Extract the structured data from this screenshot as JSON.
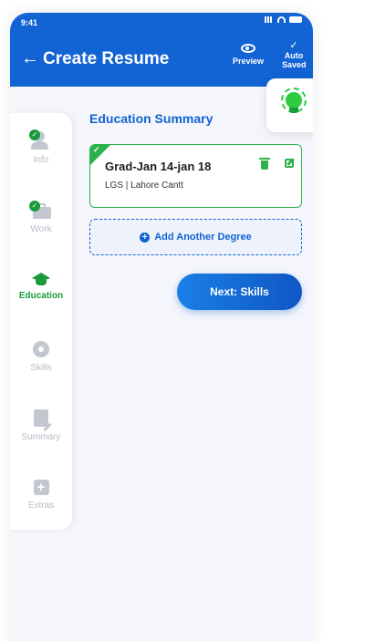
{
  "status_bar": {
    "time": "9:41"
  },
  "header": {
    "back_icon": "arrow-left-icon",
    "title": "Create Resume",
    "preview_label": "Preview",
    "autosave_line1": "Auto",
    "autosave_line2": "Saved",
    "color": "#1263d3"
  },
  "sidebar": {
    "items": [
      {
        "label": "Info",
        "icon": "person-icon",
        "completed": true,
        "active": false
      },
      {
        "label": "Work",
        "icon": "briefcase-icon",
        "completed": true,
        "active": false
      },
      {
        "label": "Education",
        "icon": "graduation-cap-icon",
        "completed": false,
        "active": true
      },
      {
        "label": "Skills",
        "icon": "gear-icon",
        "completed": false,
        "active": false
      },
      {
        "label": "Summary",
        "icon": "document-icon",
        "completed": false,
        "active": false
      },
      {
        "label": "Extras",
        "icon": "plus-square-icon",
        "completed": false,
        "active": false
      }
    ],
    "active_color": "#1a9a3a"
  },
  "main": {
    "section_title": "Education Summary",
    "tip_icon": "lightbulb-icon",
    "degrees": [
      {
        "title": "Grad-Jan 14-jan 18",
        "subtitle": "LGS | Lahore Cantt",
        "completed": true
      }
    ],
    "add_degree_label": "Add Another Degree",
    "next_button_label": "Next: Skills"
  }
}
